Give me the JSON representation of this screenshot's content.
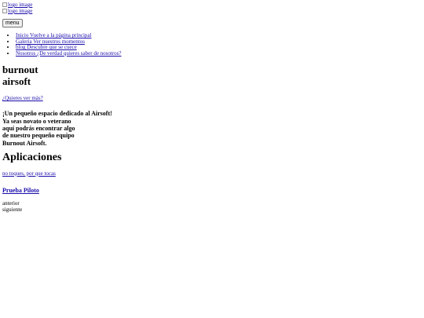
{
  "header": {
    "logo_alt_1": "logo image",
    "logo_alt_2": "logo image",
    "menu_button": "menu"
  },
  "nav": {
    "items": [
      {
        "label": "Inicio Vuelve a la página principal"
      },
      {
        "label": "Galería Ver nuestros momentos"
      },
      {
        "label": "blog Descubre que se cuece"
      },
      {
        "label": "Nosotros ¿De verdad quieres saber de nosotros?"
      }
    ]
  },
  "hero": {
    "title_line1": "burnout",
    "title_line2": "airsoft",
    "more_link": "¿Quieres ver más?",
    "intro_lines": [
      "¡Un pequeño espacio dedicado al Airsoft!",
      "Ya seas novato o veterano",
      "aquí podrás encontrar algo",
      "de nuestro pequeño equipo",
      "Burnout Airsoft."
    ]
  },
  "apps": {
    "heading": "Aplicaciones",
    "touch_link": "no toques, por que tocas",
    "item_title": "Prueba Piloto",
    "prev": "anterior",
    "next": "siguiente"
  }
}
